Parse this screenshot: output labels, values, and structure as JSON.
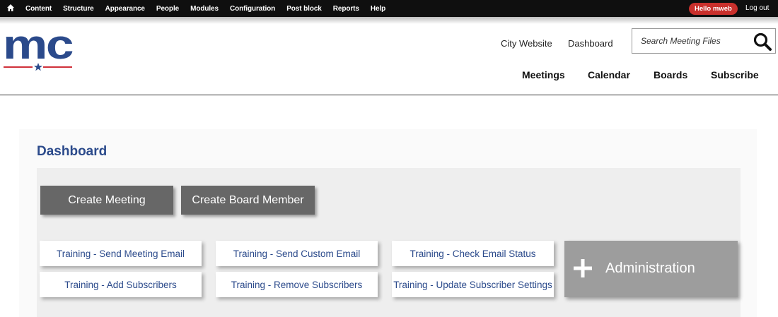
{
  "admin_toolbar": {
    "home_icon": "home-icon",
    "menu": [
      "Content",
      "Structure",
      "Appearance",
      "People",
      "Modules",
      "Configuration",
      "Post block",
      "Reports",
      "Help"
    ],
    "hello": "Hello mweb",
    "logout": "Log out"
  },
  "header": {
    "logo_text": "mc",
    "top_links": [
      "City Website",
      "Dashboard"
    ],
    "search": {
      "placeholder": "Search Meeting Files",
      "icon": "search-icon"
    },
    "main_nav": [
      "Meetings",
      "Calendar",
      "Boards",
      "Subscribe"
    ]
  },
  "dashboard": {
    "title": "Dashboard",
    "primary_buttons": [
      "Create Meeting",
      "Create Board Member"
    ],
    "training_links": [
      "Training - Send Meeting Email",
      "Training - Send Custom Email",
      "Training - Check Email Status",
      "Training - Add Subscribers",
      "Training - Remove Subscribers",
      "Training - Update Subscriber Settings"
    ],
    "administration": "Administration",
    "administration_icon": "plus-icon"
  },
  "colors": {
    "toolbar_bg": "#0f0f0f",
    "hello_badge": "#c9302c",
    "brand_blue": "#2b4a8b",
    "brand_red": "#d0313a",
    "dark_button": "#676767",
    "admin_button": "#9d9d9d",
    "panel_bg": "#eeeeee"
  }
}
